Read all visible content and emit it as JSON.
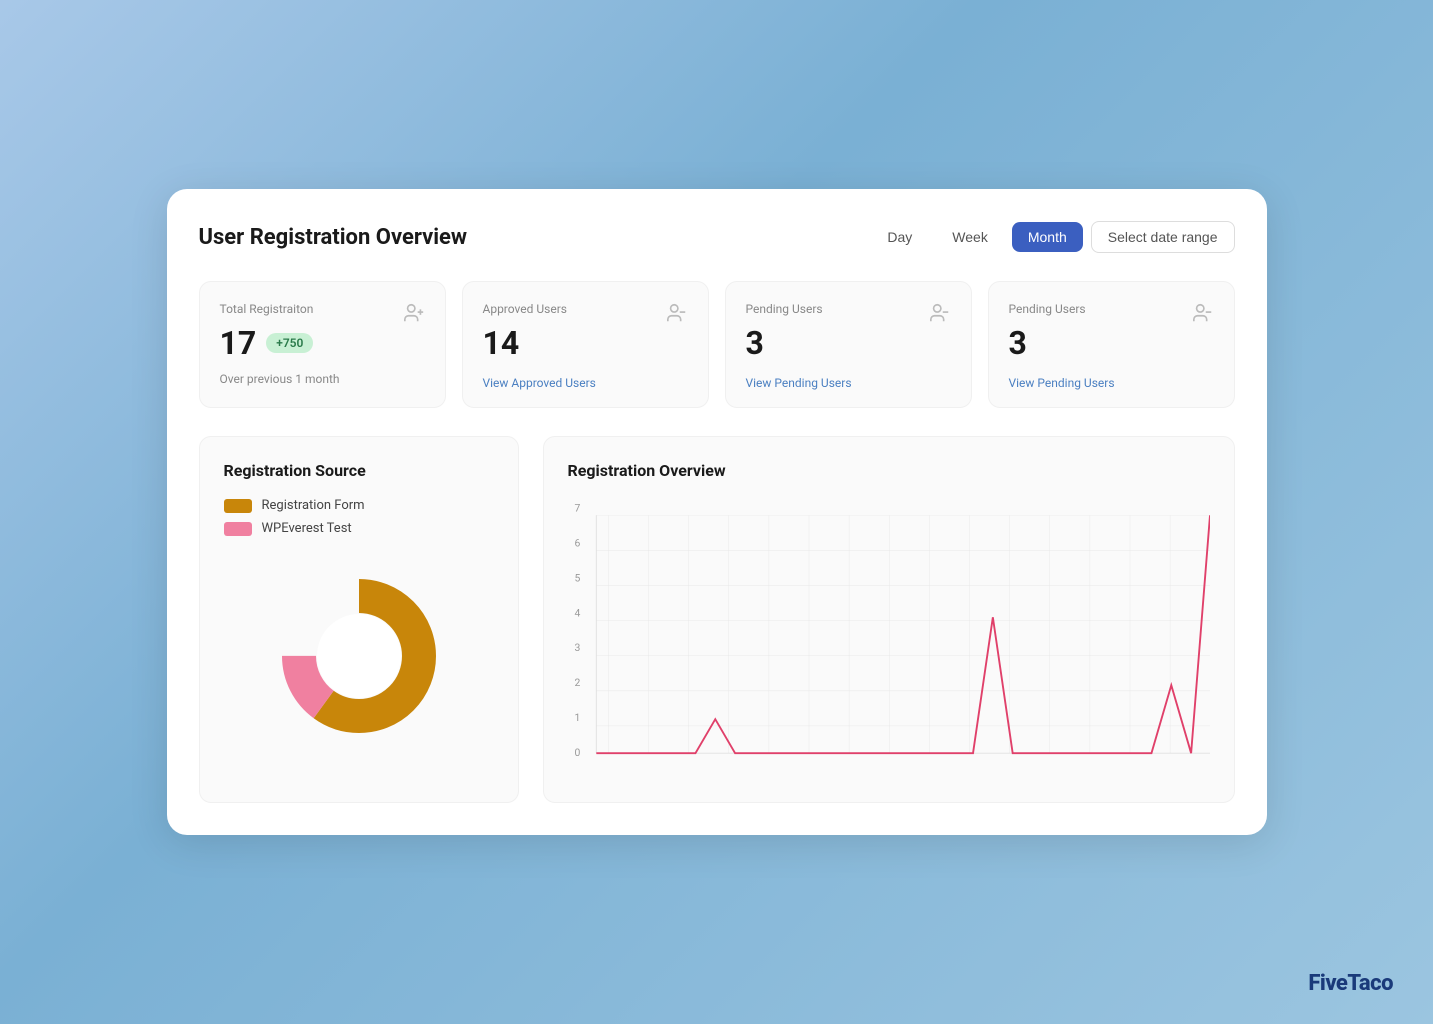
{
  "header": {
    "title": "User Registration Overview",
    "period_buttons": [
      "Day",
      "Week",
      "Month"
    ],
    "active_period": "Month",
    "date_range_label": "Select date range"
  },
  "stats": [
    {
      "label": "Total Registraiton",
      "value": "17",
      "badge": "+750",
      "sub": "Over previous 1 month",
      "link": null,
      "icon": "user-plus"
    },
    {
      "label": "Approved Users",
      "value": "14",
      "badge": null,
      "sub": null,
      "link": "View Approved Users",
      "icon": "user-minus"
    },
    {
      "label": "Pending Users",
      "value": "3",
      "badge": null,
      "sub": null,
      "link": "View Pending Users",
      "icon": "user-minus"
    },
    {
      "label": "Pending Users",
      "value": "3",
      "badge": null,
      "sub": null,
      "link": "View Pending Users",
      "icon": "user-minus"
    }
  ],
  "registration_source": {
    "title": "Registration Source",
    "legend": [
      {
        "label": "Registration Form",
        "color": "#c8860a"
      },
      {
        "label": "WPEverest Test",
        "color": "#f080a0"
      }
    ],
    "donut": {
      "segments": [
        {
          "label": "Registration Form",
          "value": 85,
          "color": "#c8860a"
        },
        {
          "label": "WPEverest Test",
          "value": 15,
          "color": "#f080a0"
        }
      ]
    }
  },
  "registration_overview": {
    "title": "Registration Overview",
    "y_labels": [
      "0",
      "1",
      "2",
      "3",
      "4",
      "5",
      "6",
      "7"
    ],
    "line_color": "#e0406a",
    "data_points": [
      0,
      0,
      0,
      0,
      0,
      0,
      1,
      0,
      0,
      0,
      0,
      0,
      0,
      0,
      0,
      0,
      0,
      0,
      0,
      0,
      4,
      0,
      0,
      0,
      0,
      0,
      0,
      0,
      0,
      2,
      0,
      7
    ]
  },
  "brand": {
    "name": "FiveTaco"
  }
}
